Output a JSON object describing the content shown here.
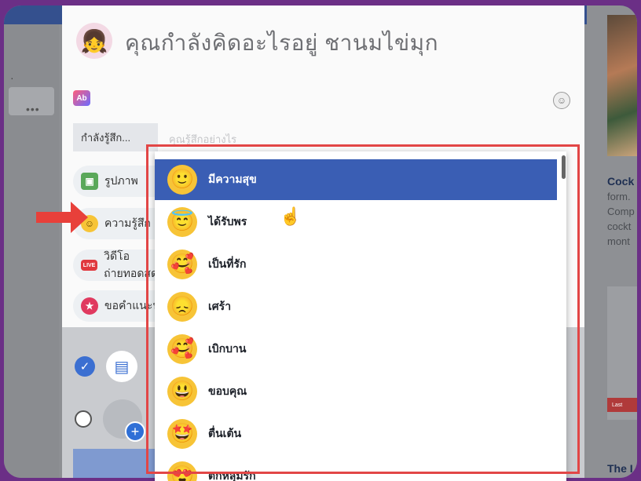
{
  "composer": {
    "prompt": "คุณกำลังคิดอะไรอยู่ ชานมไข่มุก",
    "feeling_label": "กำลังรู้สึก...",
    "feeling_placeholder": "คุณรู้สึกอย่างไร",
    "gif_badge": "Ab",
    "options": [
      {
        "label": "รูปภาพ",
        "icon": "photo-icon"
      },
      {
        "label": "ความรู้สึก",
        "icon": "smile-icon"
      },
      {
        "label": "วิดีโอถ่ายทอดสด",
        "icon": "live-icon",
        "badge": "LIVE"
      },
      {
        "label": "ขอคำแนะนำ",
        "icon": "recommend-icon"
      }
    ]
  },
  "dropdown": {
    "items": [
      {
        "label": "มีความสุข",
        "emoji": "🙂",
        "selected": true
      },
      {
        "label": "ได้รับพร",
        "emoji": "😇"
      },
      {
        "label": "เป็นที่รัก",
        "emoji": "🥰"
      },
      {
        "label": "เศร้า",
        "emoji": "😞"
      },
      {
        "label": "เบิกบาน",
        "emoji": "🥰"
      },
      {
        "label": "ขอบคุณ",
        "emoji": "😃"
      },
      {
        "label": "ตื่นเต้น",
        "emoji": "🤩"
      },
      {
        "label": "ตกหลุมรัก",
        "emoji": "😍"
      }
    ]
  },
  "right": {
    "ad_title": "Cock",
    "ad_lines": [
      "form.",
      "Comp",
      "cockt",
      "mont"
    ],
    "ad_button": "Last",
    "ad_title2": "The I"
  },
  "left": {
    "more": "•••"
  },
  "colors": {
    "accent": "#3a5eb4",
    "highlight": "#e24646",
    "frame": "#6b2f86"
  }
}
